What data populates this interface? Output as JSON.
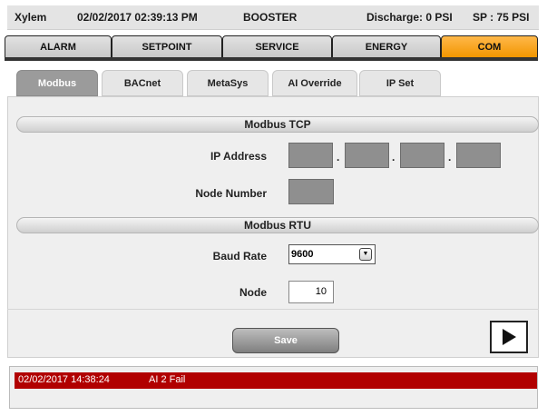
{
  "header": {
    "brand": "Xylem",
    "datetime": "02/02/2017 02:39:13 PM",
    "mode": "BOOSTER",
    "discharge": "Discharge: 0 PSI",
    "setpoint": "SP : 75 PSI"
  },
  "main_tabs": [
    {
      "label": "ALARM",
      "active": false
    },
    {
      "label": "SETPOINT",
      "active": false
    },
    {
      "label": "SERVICE",
      "active": false
    },
    {
      "label": "ENERGY",
      "active": false
    },
    {
      "label": "COM",
      "active": true
    }
  ],
  "sub_tabs": [
    {
      "label": "Modbus",
      "active": true
    },
    {
      "label": "BACnet",
      "active": false
    },
    {
      "label": "MetaSys",
      "active": false
    },
    {
      "label": "AI Override",
      "active": false
    },
    {
      "label": "IP Set",
      "active": false
    }
  ],
  "modbus_tcp": {
    "title": "Modbus TCP",
    "ip_label": "IP Address",
    "ip_separator": ".",
    "ip_octets": [
      "",
      "",
      "",
      ""
    ],
    "node_label": "Node Number",
    "node_value": ""
  },
  "modbus_rtu": {
    "title": "Modbus RTU",
    "baud_label": "Baud Rate",
    "baud_value": "9600",
    "node_label": "Node",
    "node_value": "10"
  },
  "actions": {
    "save_label": "Save",
    "next_icon": "play-arrow-icon"
  },
  "alarms": [
    {
      "timestamp": "02/02/2017 14:38:24",
      "message": "AI 2 Fail"
    }
  ],
  "colors": {
    "active_tab": "#f29600",
    "alarm_row": "#b10000",
    "subtab_active": "#9b9b9b"
  }
}
